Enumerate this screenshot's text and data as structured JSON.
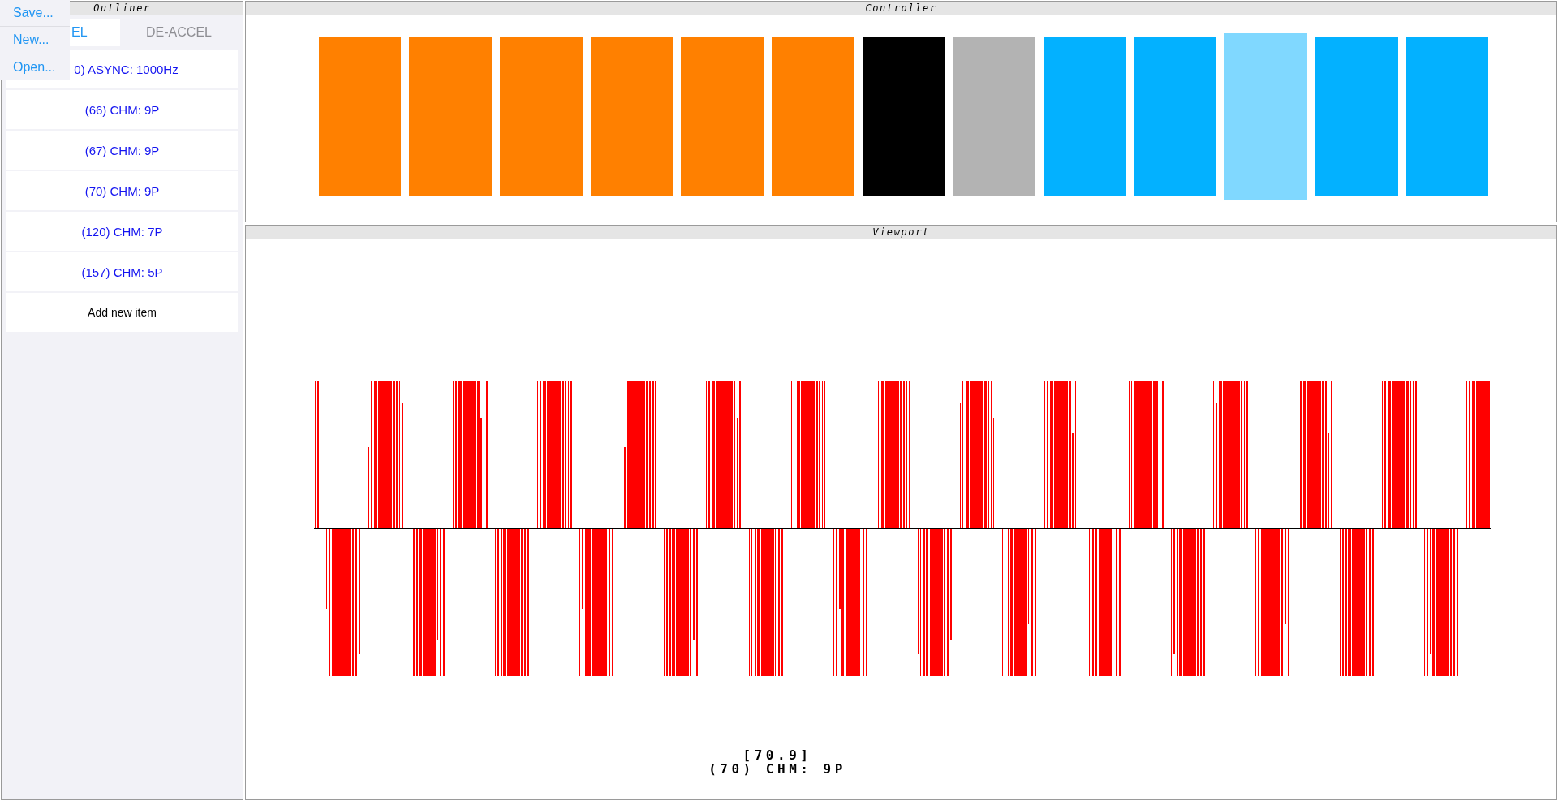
{
  "menu": {
    "items": [
      "Save...",
      "New...",
      "Open..."
    ]
  },
  "outliner": {
    "title": "Outliner",
    "tabs": [
      {
        "label": "EL",
        "selected": true
      },
      {
        "label": "DE-ACCEL",
        "selected": false
      }
    ],
    "items": [
      "0) ASYNC: 1000Hz",
      "(66) CHM: 9P",
      "(67) CHM: 9P",
      "(70) CHM: 9P",
      "(120) CHM: 7P",
      "(157) CHM: 5P"
    ],
    "add_button": "Add new item"
  },
  "controller": {
    "title": "Controller",
    "blocks": [
      {
        "color": "#ff8000",
        "selected": false
      },
      {
        "color": "#ff8000",
        "selected": false
      },
      {
        "color": "#ff8000",
        "selected": false
      },
      {
        "color": "#ff8000",
        "selected": false
      },
      {
        "color": "#ff8000",
        "selected": false
      },
      {
        "color": "#ff8000",
        "selected": false
      },
      {
        "color": "#000000",
        "selected": false
      },
      {
        "color": "#b3b3b3",
        "selected": false
      },
      {
        "color": "#03b1ff",
        "selected": false
      },
      {
        "color": "#03b1ff",
        "selected": false
      },
      {
        "color": "#80d8ff",
        "selected": true
      },
      {
        "color": "#03b1ff",
        "selected": false
      },
      {
        "color": "#03b1ff",
        "selected": false
      }
    ]
  },
  "viewport": {
    "title": "Viewport",
    "readout": [
      "[70.9]",
      "(70) CHM: 9P"
    ]
  }
}
